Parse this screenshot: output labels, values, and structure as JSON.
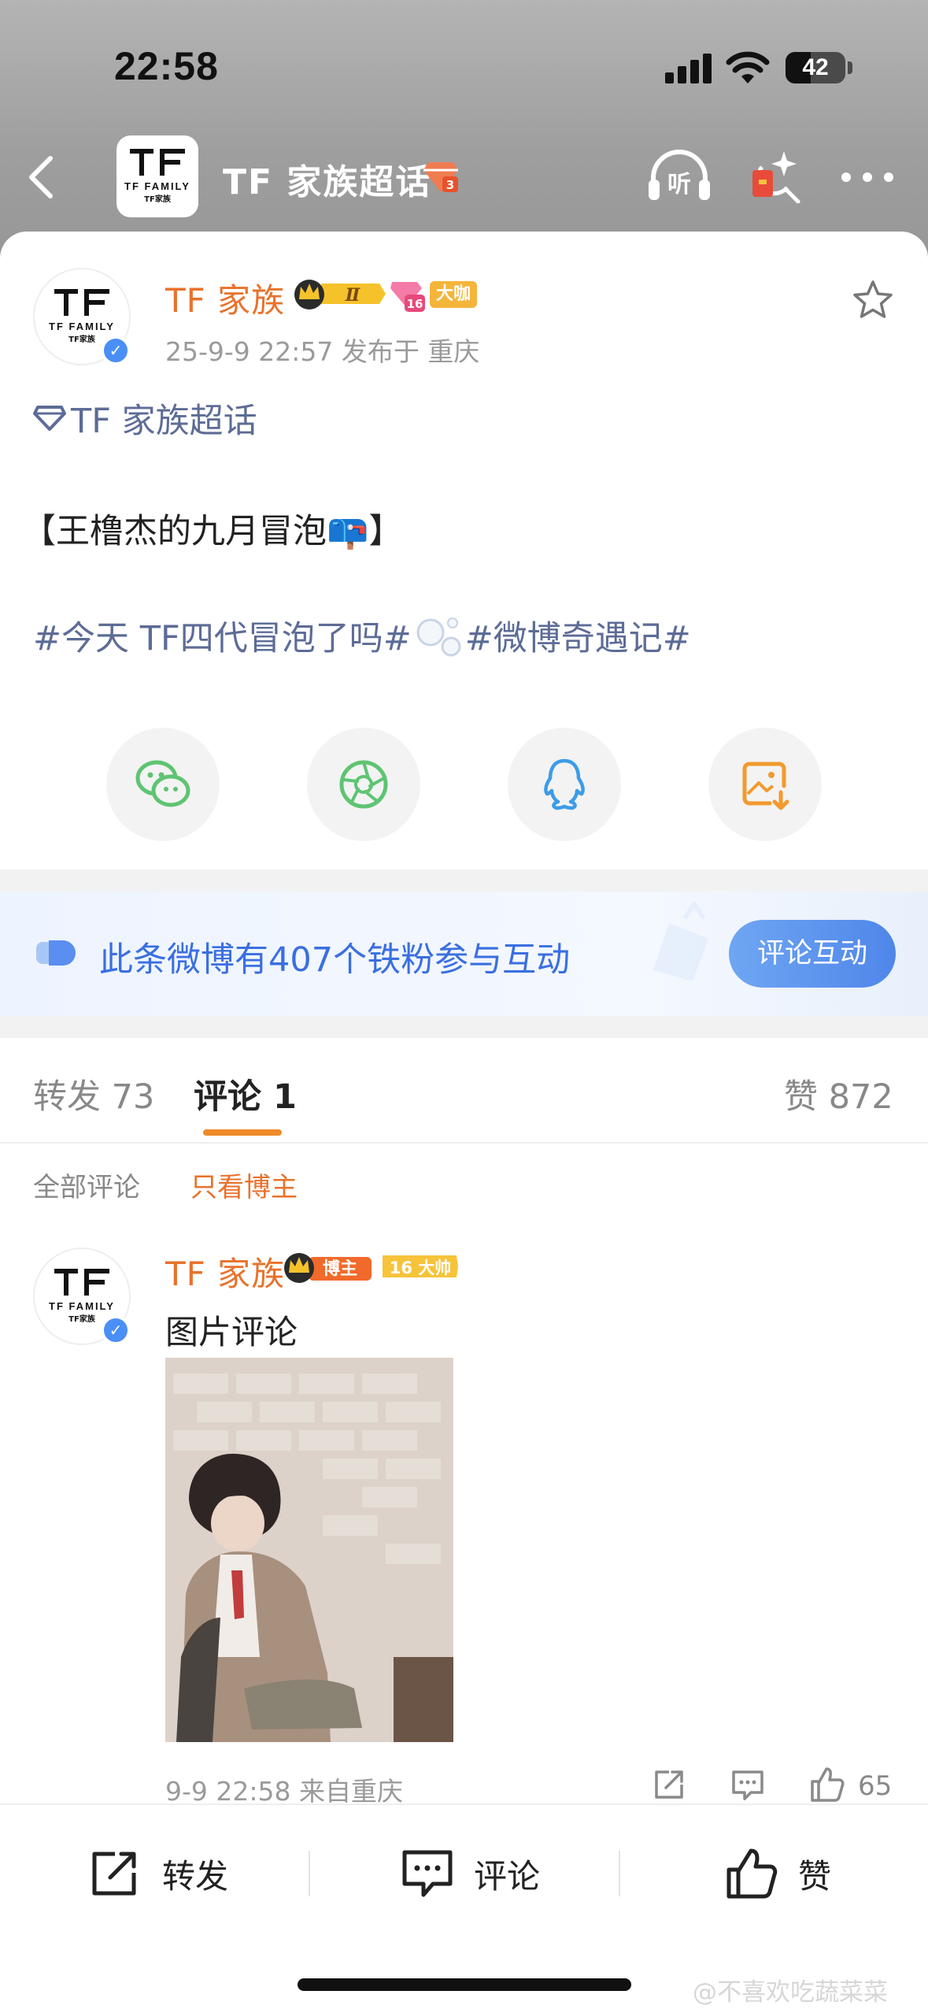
{
  "status_bar": {
    "time": "22:58",
    "battery": "42"
  },
  "header": {
    "title": "TF 家族超话",
    "listen_label": "听"
  },
  "post": {
    "author": "TF 家族",
    "crown_level": "Ⅱ",
    "level": "16",
    "tag": "大咖",
    "meta": "25-9-9 22:57  发布于 重庆",
    "topic": "TF 家族超话",
    "title": "【王橹杰的九月冒泡📪】",
    "tag1": "#今天 TF四代冒泡了吗#",
    "tag2": "#微博奇遇记#"
  },
  "logo": {
    "line1": "TF FAMILY",
    "line2": "TF家族"
  },
  "fans_banner": {
    "text": "此条微博有407个铁粉参与互动",
    "button": "评论互动"
  },
  "tabs": {
    "repost": "转发 73",
    "comments": "评论 1",
    "likes": "赞 872"
  },
  "filters": {
    "all": "全部评论",
    "author_only": "只看博主"
  },
  "comment": {
    "author": "TF 家族",
    "owner_tag": "博主",
    "level_tag": "16 大帅",
    "text": "图片评论",
    "meta": "9-9 22:58  来自重庆",
    "likes": "65"
  },
  "bottom_bar": {
    "repost": "转发",
    "comment": "评论",
    "like": "赞"
  },
  "watermark": "@不喜欢吃蔬菜菜",
  "colors": {
    "accent_orange": "#e8722b",
    "link_blue": "#5d6c96",
    "banner_blue": "#3a6fe0"
  }
}
